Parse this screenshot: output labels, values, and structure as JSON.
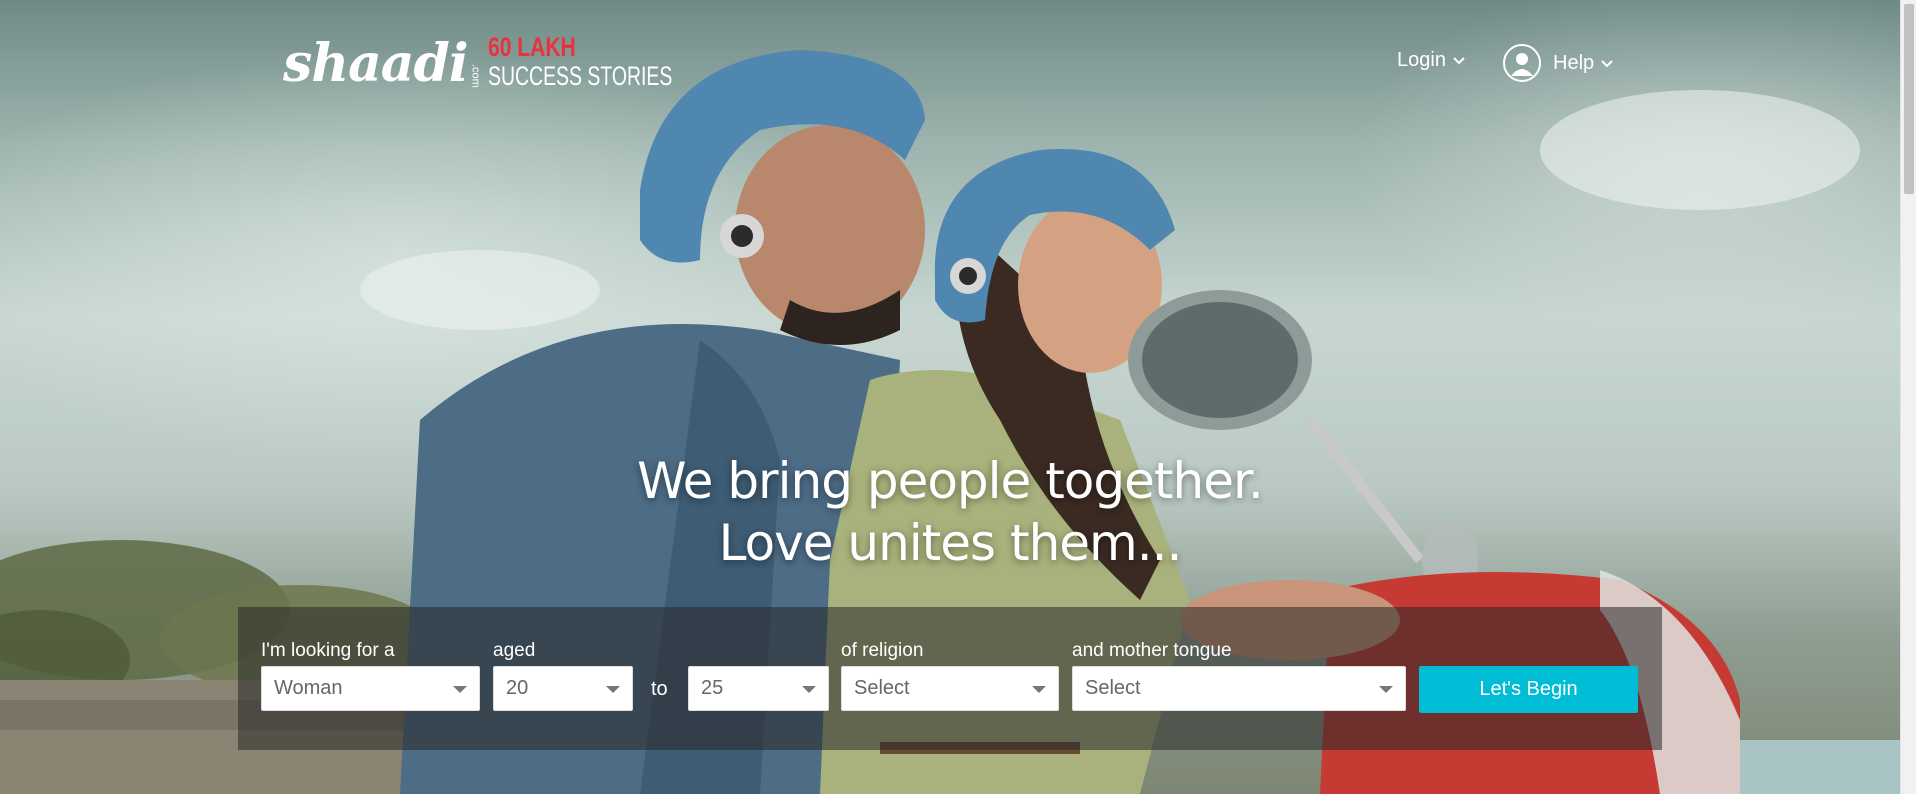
{
  "brand": {
    "logo_text": "shaadi",
    "logo_domain": ".com",
    "tagline_top": "60 LAKH",
    "tagline_bottom": "SUCCESS STORIES",
    "accent_color": "#e8333d"
  },
  "nav": {
    "login_label": "Login",
    "help_label": "Help",
    "icons": {
      "chevron": "chevron-down-icon",
      "avatar": "user-avatar-icon"
    }
  },
  "hero": {
    "headline_line1": "We bring people together.",
    "headline_line2": "Love unites them..."
  },
  "search": {
    "looking_for": {
      "label": "I'm looking for a",
      "value": "Woman"
    },
    "age": {
      "label": "aged",
      "from": "20",
      "connector": "to",
      "to": "25"
    },
    "religion": {
      "label": "of religion",
      "value": "Select"
    },
    "mother_tongue": {
      "label": "and mother tongue",
      "value": "Select"
    },
    "submit_label": "Let's Begin",
    "button_color": "#00bcd5"
  }
}
